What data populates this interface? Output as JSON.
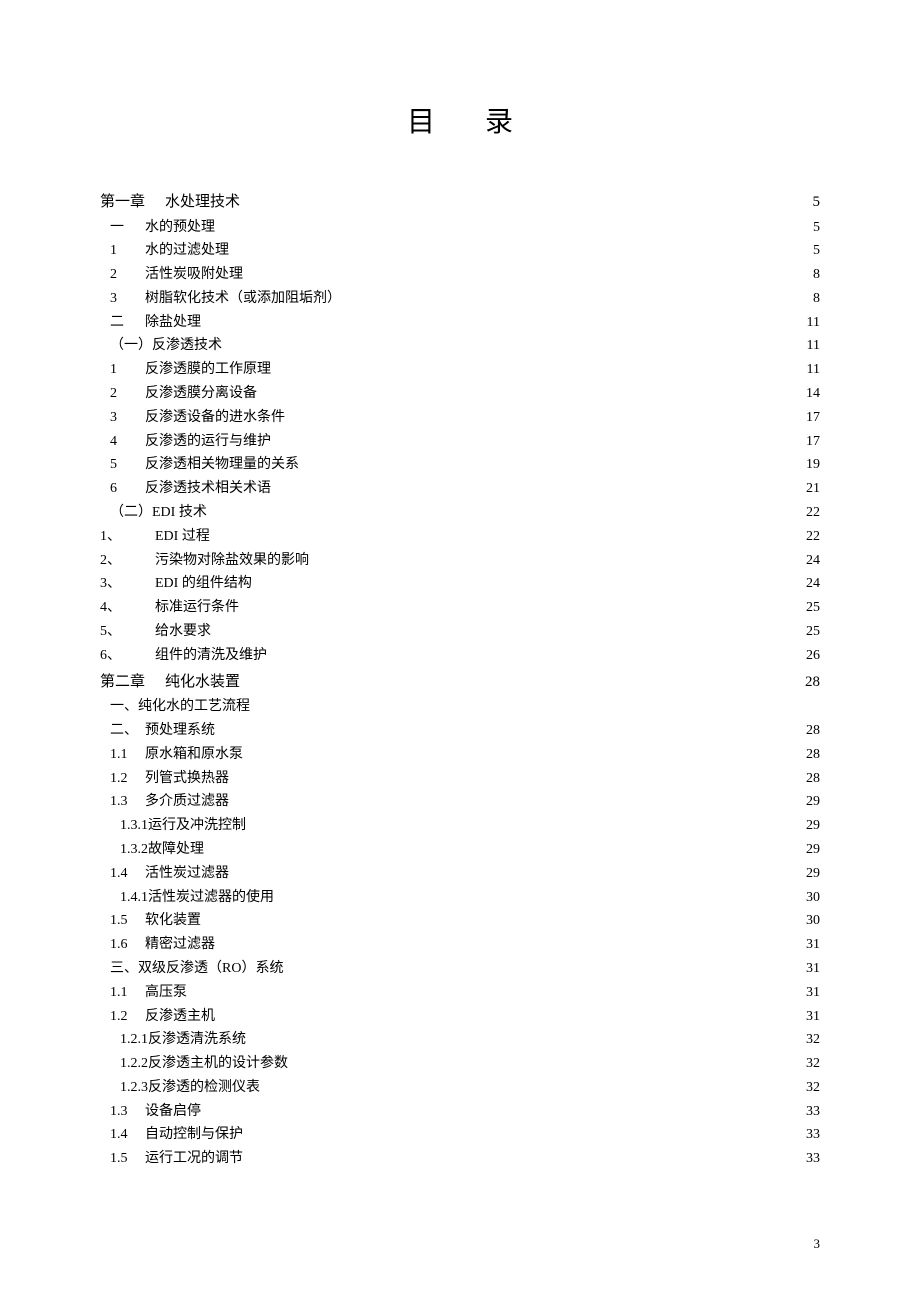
{
  "title": "目录",
  "page_number": "3",
  "entries": [
    {
      "type": "chapter",
      "label": "第一章",
      "text": "水处理技术",
      "page": "5",
      "dotStyle": "wide"
    },
    {
      "type": "col1b",
      "label": "一",
      "text": "水的预处理",
      "page": "5"
    },
    {
      "type": "col2",
      "label": "1",
      "text": "水的过滤处理",
      "page": "5"
    },
    {
      "type": "col2",
      "label": "2",
      "text": "活性炭吸附处理",
      "page": "8"
    },
    {
      "type": "col2",
      "label": "3",
      "text": "树脂软化技术（或添加阻垢剂）",
      "page": "8"
    },
    {
      "type": "col1b",
      "label": "二",
      "text": "除盐处理",
      "page": "11"
    },
    {
      "type": "noprefix",
      "label": "",
      "text": "（一）反渗透技术",
      "page": "11"
    },
    {
      "type": "col2",
      "label": "1",
      "text": "反渗透膜的工作原理",
      "page": "11"
    },
    {
      "type": "col2",
      "label": "2",
      "text": "反渗透膜分离设备",
      "page": "14"
    },
    {
      "type": "col2",
      "label": "3",
      "text": "反渗透设备的进水条件",
      "page": "17"
    },
    {
      "type": "col2",
      "label": "4",
      "text": "反渗透的运行与维护",
      "page": "17"
    },
    {
      "type": "col2",
      "label": "5",
      "text": "反渗透相关物理量的关系",
      "page": "19"
    },
    {
      "type": "col2",
      "label": "6",
      "text": "反渗透技术相关术语",
      "page": "21"
    },
    {
      "type": "noprefix",
      "label": "",
      "text": "（二）EDI 技术",
      "page": "22"
    },
    {
      "type": "col1",
      "label": "1、",
      "text": "EDI 过程",
      "page": "22"
    },
    {
      "type": "col1",
      "label": "2、",
      "text": "污染物对除盐效果的影响",
      "page": "24"
    },
    {
      "type": "col1",
      "label": "3、",
      "text": "EDI 的组件结构",
      "page": "24"
    },
    {
      "type": "col1",
      "label": "4、",
      "text": "标准运行条件",
      "page": "25"
    },
    {
      "type": "col1",
      "label": "5、",
      "text": "给水要求",
      "page": "25"
    },
    {
      "type": "col1",
      "label": "6、",
      "text": "组件的清洗及维护",
      "page": "26"
    },
    {
      "type": "chapter",
      "label": "第二章",
      "text": "纯化水装置",
      "page": "28",
      "dotStyle": "wide"
    },
    {
      "type": "noprefix",
      "label": "",
      "text": "一、纯化水的工艺流程",
      "page": "",
      "nopage": true
    },
    {
      "type": "col1b",
      "label": "二、",
      "text": "预处理系统",
      "page": "28"
    },
    {
      "type": "col2",
      "label": "1.1",
      "text": "原水箱和原水泵",
      "page": "28"
    },
    {
      "type": "col2",
      "label": "1.2",
      "text": "列管式换热器",
      "page": "28"
    },
    {
      "type": "col2",
      "label": "1.3",
      "text": "多介质过滤器",
      "page": "29"
    },
    {
      "type": "col3",
      "label": "1.3.1",
      "text": "运行及冲洗控制",
      "page": "29"
    },
    {
      "type": "col3",
      "label": "1.3.2",
      "text": "故障处理",
      "page": "29"
    },
    {
      "type": "col2",
      "label": "1.4",
      "text": "活性炭过滤器",
      "page": "29"
    },
    {
      "type": "col3",
      "label": "1.4.1",
      "text": "活性炭过滤器的使用",
      "page": "30"
    },
    {
      "type": "col2",
      "label": "1.5",
      "text": "软化装置",
      "page": "30"
    },
    {
      "type": "col2",
      "label": "1.6",
      "text": "精密过滤器",
      "page": "31"
    },
    {
      "type": "noprefix",
      "label": "",
      "text": "三、双级反渗透（RO）系统",
      "page": "31"
    },
    {
      "type": "col2",
      "label": "1.1",
      "text": "高压泵",
      "page": "31"
    },
    {
      "type": "col2",
      "label": "1.2",
      "text": "反渗透主机",
      "page": "31"
    },
    {
      "type": "col3",
      "label": "1.2.1",
      "text": "反渗透清洗系统",
      "page": "32"
    },
    {
      "type": "col3",
      "label": "1.2.2",
      "text": "反渗透主机的设计参数",
      "page": "32"
    },
    {
      "type": "col3",
      "label": "1.2.3",
      "text": "反渗透的检测仪表",
      "page": "32"
    },
    {
      "type": "col2",
      "label": "1.3",
      "text": "设备启停",
      "page": "33"
    },
    {
      "type": "col2",
      "label": "1.4",
      "text": "自动控制与保护",
      "page": "33"
    },
    {
      "type": "col2",
      "label": "1.5",
      "text": "运行工况的调节",
      "page": "33"
    }
  ]
}
